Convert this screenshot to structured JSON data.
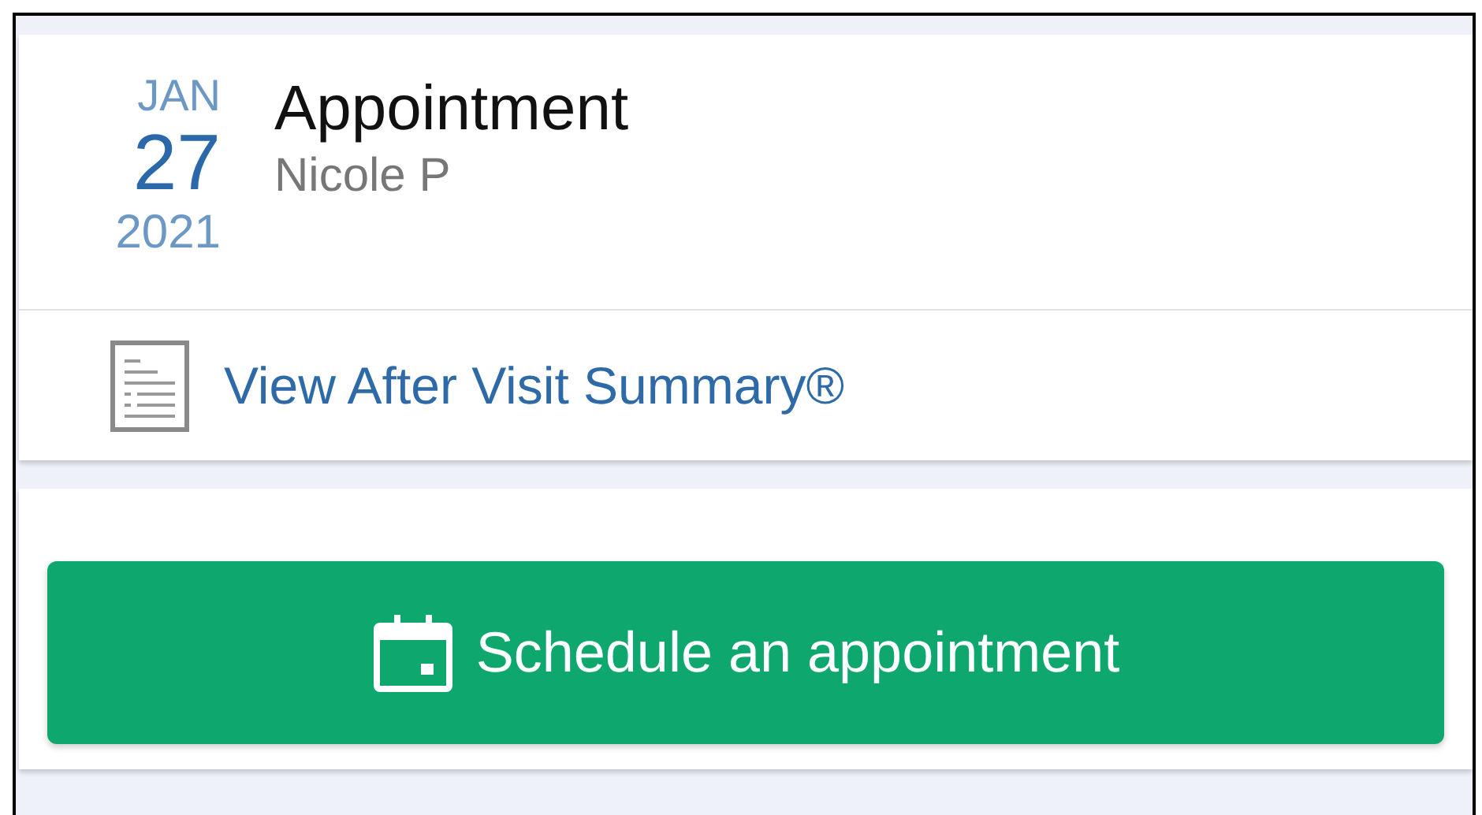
{
  "appointments": [
    {
      "month": "JAN",
      "day": "27",
      "year": "2021",
      "title": "Appointment",
      "provider": "Nicole P",
      "link": "View After Visit Summary®"
    }
  ],
  "schedule_button": {
    "label": "Schedule an appointment"
  }
}
